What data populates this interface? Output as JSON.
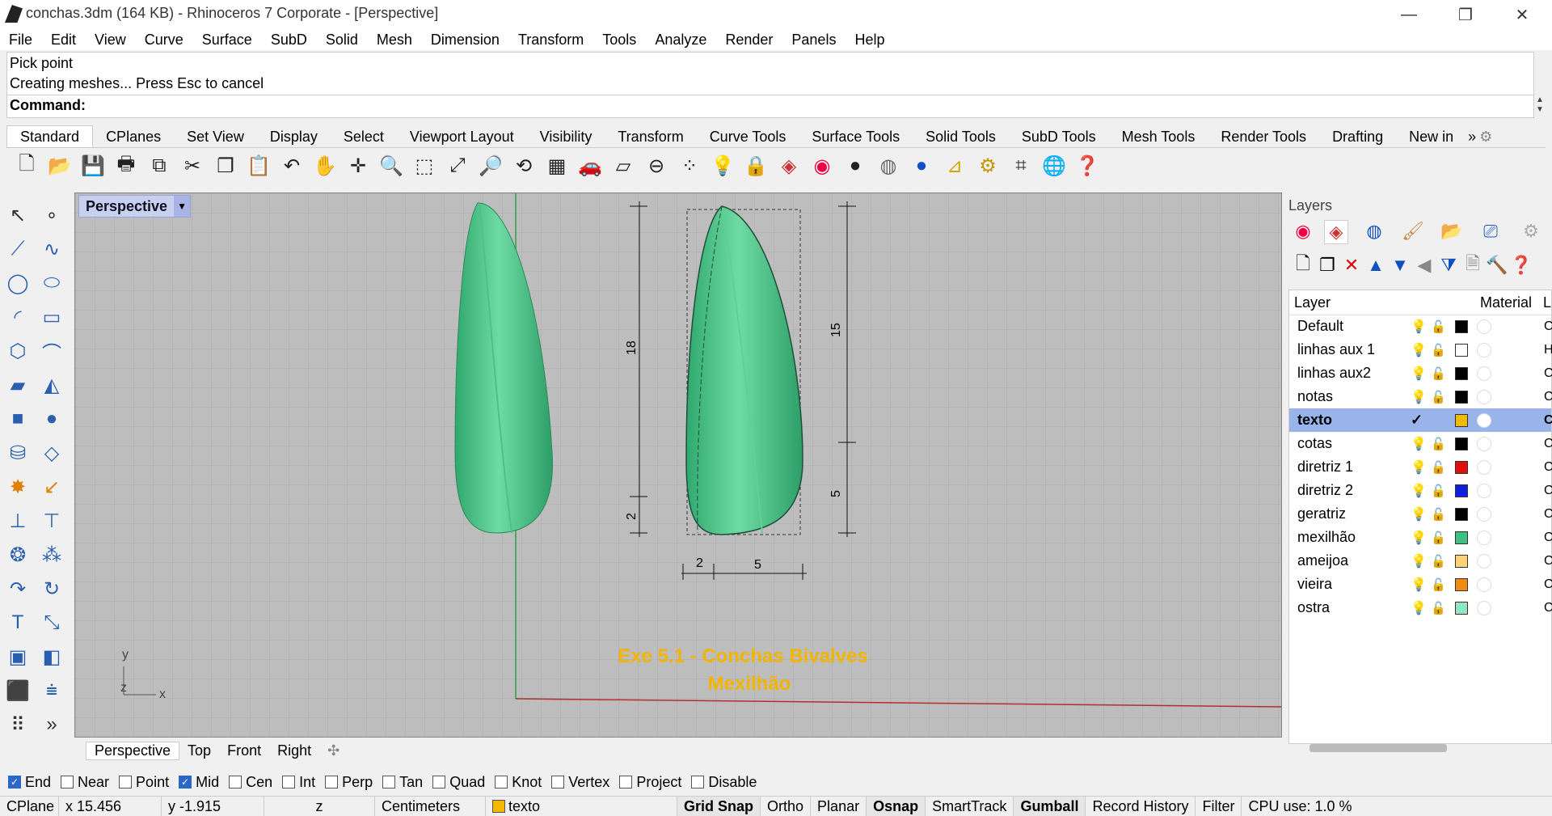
{
  "window": {
    "title": "conchas.3dm (164 KB) - Rhinoceros 7 Corporate - [Perspective]",
    "minimize": "—",
    "restore": "❐",
    "close": "✕"
  },
  "menu": [
    "File",
    "Edit",
    "View",
    "Curve",
    "Surface",
    "SubD",
    "Solid",
    "Mesh",
    "Dimension",
    "Transform",
    "Tools",
    "Analyze",
    "Render",
    "Panels",
    "Help"
  ],
  "command": {
    "history": [
      "Pick point",
      "Creating meshes... Press Esc to cancel"
    ],
    "prompt": "Command:"
  },
  "toolbar_tabs": [
    "Standard",
    "CPlanes",
    "Set View",
    "Display",
    "Select",
    "Viewport Layout",
    "Visibility",
    "Transform",
    "Curve Tools",
    "Surface Tools",
    "Solid Tools",
    "SubD Tools",
    "Mesh Tools",
    "Render Tools",
    "Drafting",
    "New in"
  ],
  "toolbar_more": "»",
  "viewport": {
    "name": "Perspective",
    "dropdown": "▼",
    "dimensions": {
      "d18": "18",
      "d2v": "2",
      "d15": "15",
      "d5v": "5",
      "d2h": "2",
      "d5h": "5"
    },
    "annotation_line1": "Exe 5.1 - Conchas Bivalves",
    "annotation_line2": "Mexilhão",
    "axis": {
      "y": "y",
      "z": "z",
      "x": "x"
    },
    "colors": {
      "shell": "#3fbf82",
      "annotation": "#f2b400",
      "grid_bg": "#bdbdbd"
    }
  },
  "viewport_tabs": [
    "Perspective",
    "Top",
    "Front",
    "Right"
  ],
  "viewport_tab_add": "✣",
  "panel": {
    "title": "Layers",
    "header": {
      "layer": "Layer",
      "material": "Material",
      "extra": "L"
    },
    "layers": [
      {
        "name": "Default",
        "color": "#000000",
        "current": false,
        "suffix": "C"
      },
      {
        "name": "linhas aux 1",
        "color": "#ffffff",
        "current": false,
        "suffix": "H"
      },
      {
        "name": "linhas aux2",
        "color": "#000000",
        "current": false,
        "suffix": "C"
      },
      {
        "name": "notas",
        "color": "#000000",
        "current": false,
        "suffix": "C"
      },
      {
        "name": "texto",
        "color": "#f5b800",
        "current": true,
        "suffix": "C",
        "check": "✓"
      },
      {
        "name": "cotas",
        "color": "#000000",
        "current": false,
        "suffix": "C"
      },
      {
        "name": "diretriz 1",
        "color": "#e01010",
        "current": false,
        "suffix": "C"
      },
      {
        "name": "diretriz 2",
        "color": "#1020e0",
        "current": false,
        "suffix": "C"
      },
      {
        "name": "geratriz",
        "color": "#000000",
        "current": false,
        "suffix": "C"
      },
      {
        "name": "mexilhão",
        "color": "#3fbf82",
        "current": false,
        "suffix": "C"
      },
      {
        "name": "ameijoa",
        "color": "#ffd27a",
        "current": false,
        "suffix": "C"
      },
      {
        "name": "vieira",
        "color": "#f08a10",
        "current": false,
        "suffix": "C"
      },
      {
        "name": "ostra",
        "color": "#8fe8c0",
        "current": false,
        "suffix": "C"
      }
    ]
  },
  "osnap": [
    {
      "label": "End",
      "checked": true
    },
    {
      "label": "Near",
      "checked": false
    },
    {
      "label": "Point",
      "checked": false
    },
    {
      "label": "Mid",
      "checked": true
    },
    {
      "label": "Cen",
      "checked": false
    },
    {
      "label": "Int",
      "checked": false
    },
    {
      "label": "Perp",
      "checked": false
    },
    {
      "label": "Tan",
      "checked": false
    },
    {
      "label": "Quad",
      "checked": false
    },
    {
      "label": "Knot",
      "checked": false
    },
    {
      "label": "Vertex",
      "checked": false
    },
    {
      "label": "Project",
      "checked": false
    },
    {
      "label": "Disable",
      "checked": false
    }
  ],
  "status": {
    "cplane": "CPlane",
    "x": "x 15.456",
    "y": "y -1.915",
    "z": "z",
    "units": "Centimeters",
    "layer": "texto",
    "grid_snap": "Grid Snap",
    "ortho": "Ortho",
    "planar": "Planar",
    "osnap": "Osnap",
    "smarttrack": "SmartTrack",
    "gumball": "Gumball",
    "record_history": "Record History",
    "filter": "Filter",
    "cpu": "CPU use: 1.0 %"
  }
}
